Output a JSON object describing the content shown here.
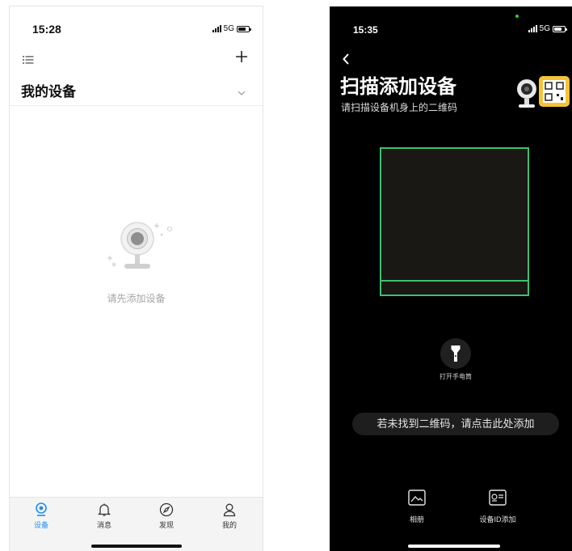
{
  "left_screen": {
    "status_bar": {
      "time": "15:28",
      "network": "5G"
    },
    "header": {
      "title": "我的设备"
    },
    "empty_state": {
      "message": "请先添加设备"
    },
    "tabs": [
      {
        "label": "设备",
        "icon": "camera-icon",
        "active": true
      },
      {
        "label": "消息",
        "icon": "bell-icon",
        "active": false
      },
      {
        "label": "发现",
        "icon": "compass-icon",
        "active": false
      },
      {
        "label": "我的",
        "icon": "person-icon",
        "active": false
      }
    ]
  },
  "right_screen": {
    "status_bar": {
      "time": "15:35",
      "network": "5G"
    },
    "title": "扫描添加设备",
    "subtitle": "请扫描设备机身上的二维码",
    "flashlight": {
      "label": "打开手电筒"
    },
    "hint_button": {
      "label": "若未找到二维码，请点击此处添加"
    },
    "bottom_actions": [
      {
        "label": "相册",
        "icon": "image-icon"
      },
      {
        "label": "设备ID添加",
        "icon": "device-id-icon"
      }
    ]
  },
  "colors": {
    "accent_blue": "#1f8ef1",
    "scan_green": "#3fc06f",
    "left_background": "#ffffff",
    "right_background": "#000000"
  }
}
